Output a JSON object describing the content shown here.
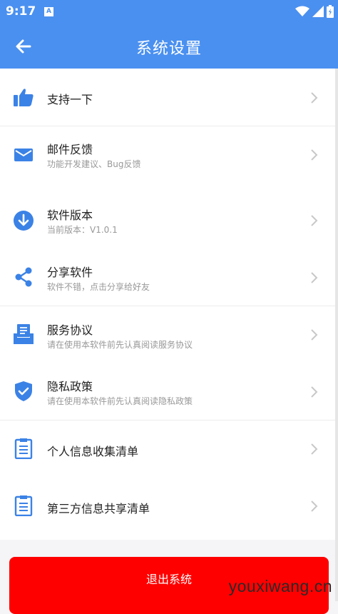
{
  "status_bar": {
    "time": "9:17",
    "notification_icon_letter": "A"
  },
  "header": {
    "title": "系统设置",
    "back_icon": "arrow-left-icon"
  },
  "items": [
    {
      "title": "支持一下",
      "subtitle": "",
      "icon": "thumbs-up-icon"
    },
    {
      "title": "邮件反馈",
      "subtitle": "功能开发建议、Bug反馈",
      "icon": "mail-icon"
    },
    {
      "title": "软件版本",
      "subtitle": "当前版本：V1.0.1",
      "icon": "download-circle-icon"
    },
    {
      "title": "分享软件",
      "subtitle": "软件不错，点击分享给好友",
      "icon": "share-icon"
    },
    {
      "title": "服务协议",
      "subtitle": "请在使用本软件前先认真阅读服务协议",
      "icon": "inbox-document-icon"
    },
    {
      "title": "隐私政策",
      "subtitle": "请在使用本软件前先认真阅读隐私政策",
      "icon": "shield-check-icon"
    },
    {
      "title": "个人信息收集清单",
      "subtitle": "",
      "icon": "clipboard-list-icon"
    },
    {
      "title": "第三方信息共享清单",
      "subtitle": "",
      "icon": "clipboard-list-icon"
    }
  ],
  "logout_label": "退出系统",
  "watermark": "youxiwang.cn",
  "colors": {
    "primary": "#4a90f0",
    "icon": "#3b82e6",
    "danger": "#ff0000",
    "chevron": "#c8c8c8"
  }
}
